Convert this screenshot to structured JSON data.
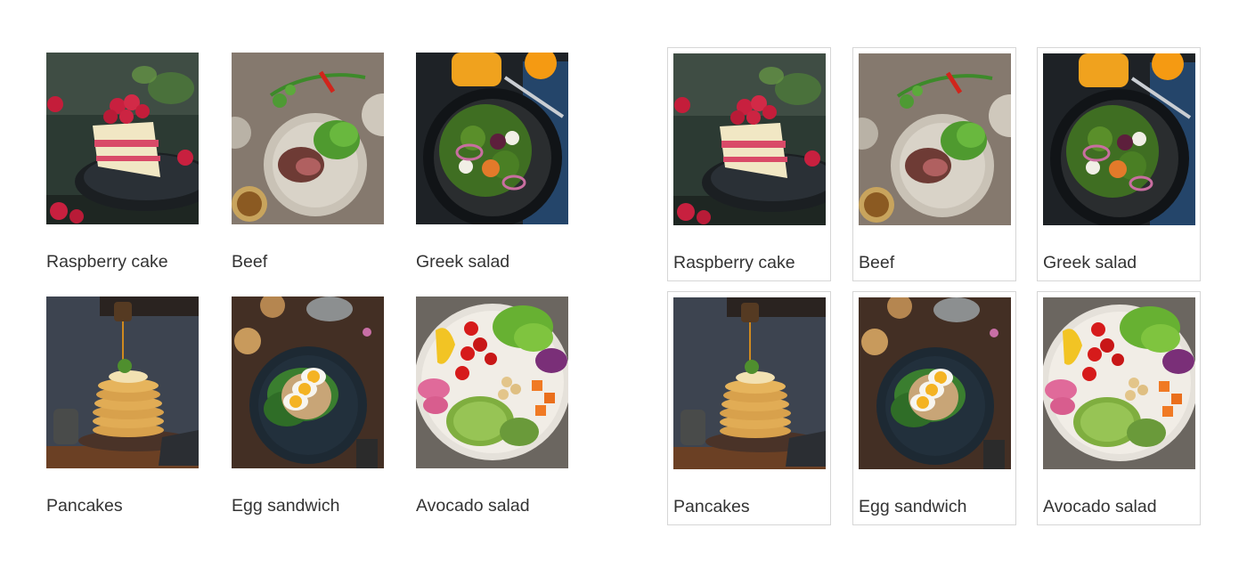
{
  "galleries": [
    {
      "style": "plain",
      "items": [
        {
          "caption": "Raspberry cake",
          "image": "raspberry-cake-photo"
        },
        {
          "caption": "Beef",
          "image": "beef-photo"
        },
        {
          "caption": "Greek salad",
          "image": "greek-salad-photo"
        },
        {
          "caption": "Pancakes",
          "image": "pancakes-photo"
        },
        {
          "caption": "Egg sandwich",
          "image": "egg-sandwich-photo"
        },
        {
          "caption": "Avocado salad",
          "image": "avocado-salad-photo"
        }
      ]
    },
    {
      "style": "bordered",
      "items": [
        {
          "caption": "Raspberry cake",
          "image": "raspberry-cake-photo"
        },
        {
          "caption": "Beef",
          "image": "beef-photo"
        },
        {
          "caption": "Greek salad",
          "image": "greek-salad-photo"
        },
        {
          "caption": "Pancakes",
          "image": "pancakes-photo"
        },
        {
          "caption": "Egg sandwich",
          "image": "egg-sandwich-photo"
        },
        {
          "caption": "Avocado salad",
          "image": "avocado-salad-photo"
        }
      ]
    }
  ],
  "colors": {
    "caption_text": "#333333",
    "tile_border": "#d6d6d6",
    "background": "#ffffff"
  }
}
